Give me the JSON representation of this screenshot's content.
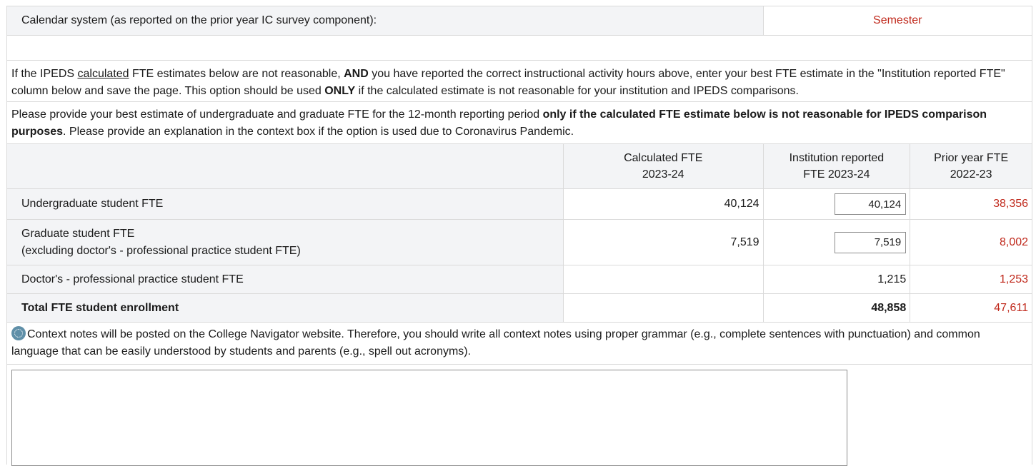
{
  "calendar": {
    "label": "Calendar system (as reported on the prior year IC survey component):",
    "value": "Semester"
  },
  "instructions": {
    "p1_a": "If the IPEDS ",
    "p1_link": "calculated",
    "p1_b": " FTE estimates below are not reasonable, ",
    "p1_and": "AND",
    "p1_c": " you have reported the correct instructional activity hours above, enter your best FTE estimate in the \"Institution reported FTE\" column below and save the page. This option should be used ",
    "p1_only": "ONLY",
    "p1_d": " if the calculated estimate is not reasonable for your institution and IPEDS comparisons.",
    "p2_a": "Please provide your best estimate of undergraduate and graduate FTE for the 12-month reporting period ",
    "p2_bold": "only if the calculated FTE estimate below is not reasonable for IPEDS comparison purposes",
    "p2_b": ". Please provide an explanation in the context box if the option is used due to Coronavirus Pandemic."
  },
  "table": {
    "headers": {
      "calc_line1": "Calculated FTE",
      "calc_line2": "2023-24",
      "inst_line1": "Institution reported",
      "inst_line2": "FTE 2023-24",
      "prior_line1": "Prior year FTE",
      "prior_line2": "2022-23"
    },
    "rows": [
      {
        "label": "Undergraduate student FTE",
        "calc": "40,124",
        "inst": "40,124",
        "prior": "38,356"
      },
      {
        "label": "Graduate student FTE",
        "label2": "(excluding doctor's - professional practice student FTE)",
        "calc": "7,519",
        "inst": "7,519",
        "prior": "8,002"
      },
      {
        "label": "Doctor's - professional practice student FTE",
        "calc": "",
        "inst": "1,215",
        "prior": "1,253"
      },
      {
        "label": "Total FTE student enrollment",
        "calc": "",
        "inst": "48,858",
        "prior": "47,611"
      }
    ]
  },
  "context": {
    "note": "Context notes will be posted on the College Navigator website. Therefore, you should write all context notes using proper grammar (e.g., complete sentences with punctuation) and common language that can be easily understood by students and parents (e.g., spell out acronyms).",
    "icon": "info-icon",
    "textarea_value": ""
  },
  "colors": {
    "prior_value": "#c0291c",
    "label_bg": "#f3f4f6",
    "border": "#dadada"
  }
}
